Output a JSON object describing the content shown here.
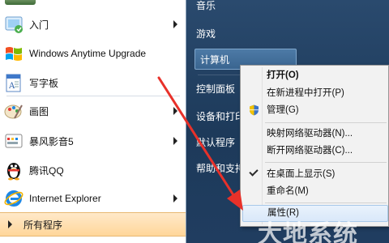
{
  "programs": [
    {
      "label": "入门",
      "icon": "getting-started-icon",
      "has_submenu": true
    },
    {
      "label": "Windows Anytime Upgrade",
      "icon": "windows-flag-icon",
      "has_submenu": false
    },
    {
      "label": "写字板",
      "icon": "wordpad-icon",
      "has_submenu": false
    },
    {
      "label": "画图",
      "icon": "paint-icon",
      "has_submenu": true
    },
    {
      "label": "暴风影音5",
      "icon": "media-player-icon",
      "has_submenu": true
    },
    {
      "label": "腾讯QQ",
      "icon": "qq-penguin-icon",
      "has_submenu": false
    },
    {
      "label": "Internet Explorer",
      "icon": "internet-explorer-icon",
      "has_submenu": true
    }
  ],
  "all_programs_label": "所有程序",
  "right_items": {
    "music": "音乐",
    "games": "游戏",
    "computer": "计算机",
    "control_panel": "控制面板",
    "devices": "设备和打印机",
    "default_programs": "默认程序",
    "help": "帮助和支持"
  },
  "context_menu": {
    "open": "打开(O)",
    "open_new_process": "在新进程中打开(P)",
    "manage": "管理(G)",
    "map_drive": "映射网络驱动器(N)...",
    "disconnect_drive": "断开网络驱动器(C)...",
    "show_on_desktop": "在桌面上显示(S)",
    "rename": "重命名(M)",
    "properties": "属性(R)"
  },
  "watermark": "大地系统",
  "colors": {
    "arrow": "#e8312a",
    "highlight": "#ffd69a",
    "right_pane": "#1d3a5a"
  }
}
